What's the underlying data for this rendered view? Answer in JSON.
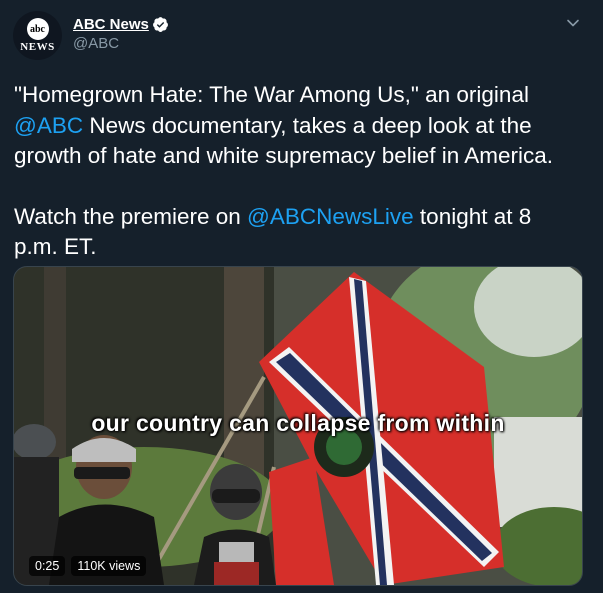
{
  "account": {
    "logo_text_top": "abc",
    "logo_text_bottom": "NEWS",
    "display_name": "ABC News",
    "handle": "@ABC",
    "verified": true
  },
  "tweet": {
    "part1_before": "\"Homegrown Hate: The War Among Us,\" an original ",
    "part1_mention": "@ABC",
    "part1_after": " News documentary, takes a deep look at the growth of hate and white supremacy belief in America.",
    "part2_before": "Watch the premiere on ",
    "part2_mention": "@ABCNewsLive",
    "part2_after": " tonight at 8 p.m. ET."
  },
  "video": {
    "caption": "our country can collapse from within",
    "duration": "0:25",
    "views": "110K views"
  },
  "colors": {
    "background": "#15202b",
    "mention": "#1da1f2",
    "secondary_text": "#8899a6",
    "verified_badge": "#ffffff"
  },
  "icons": {
    "verified": "verified-badge-icon",
    "menu": "chevron-down-icon"
  }
}
